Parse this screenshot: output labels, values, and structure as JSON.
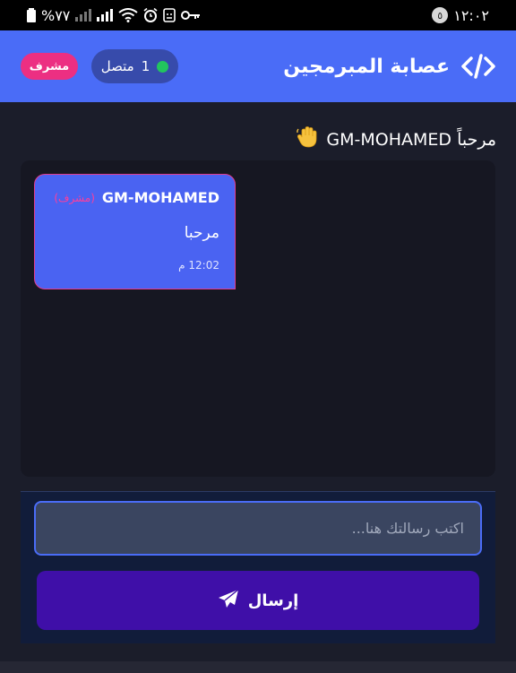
{
  "status_bar": {
    "time": "١٢:٠٢",
    "notification_count": "٥",
    "battery": "%٧٧",
    "icons": [
      "key-icon",
      "android-icon",
      "alarm-icon",
      "wifi-icon",
      "signal-icon",
      "signal-icon",
      "battery-icon"
    ]
  },
  "header": {
    "title": "عصابة المبرمجين",
    "online_count": "1",
    "online_label": "متصل",
    "admin_badge": "مشرف",
    "colors": {
      "header_bg": "#4a6cf7",
      "online_dot": "#22c55e",
      "admin_badge": "#ec2f82"
    }
  },
  "welcome": {
    "text": "مرحباً GM-MOHAMED",
    "icon": "waving-hand-icon"
  },
  "messages": [
    {
      "sender": "GM-MOHAMED",
      "role": "(مشرف)",
      "text": "مرحبا",
      "time": "12:02 م"
    }
  ],
  "composer": {
    "placeholder": "اكتب رسالتك هنا...",
    "value": "",
    "send_label": "إرسال",
    "send_icon": "paper-plane-icon"
  }
}
